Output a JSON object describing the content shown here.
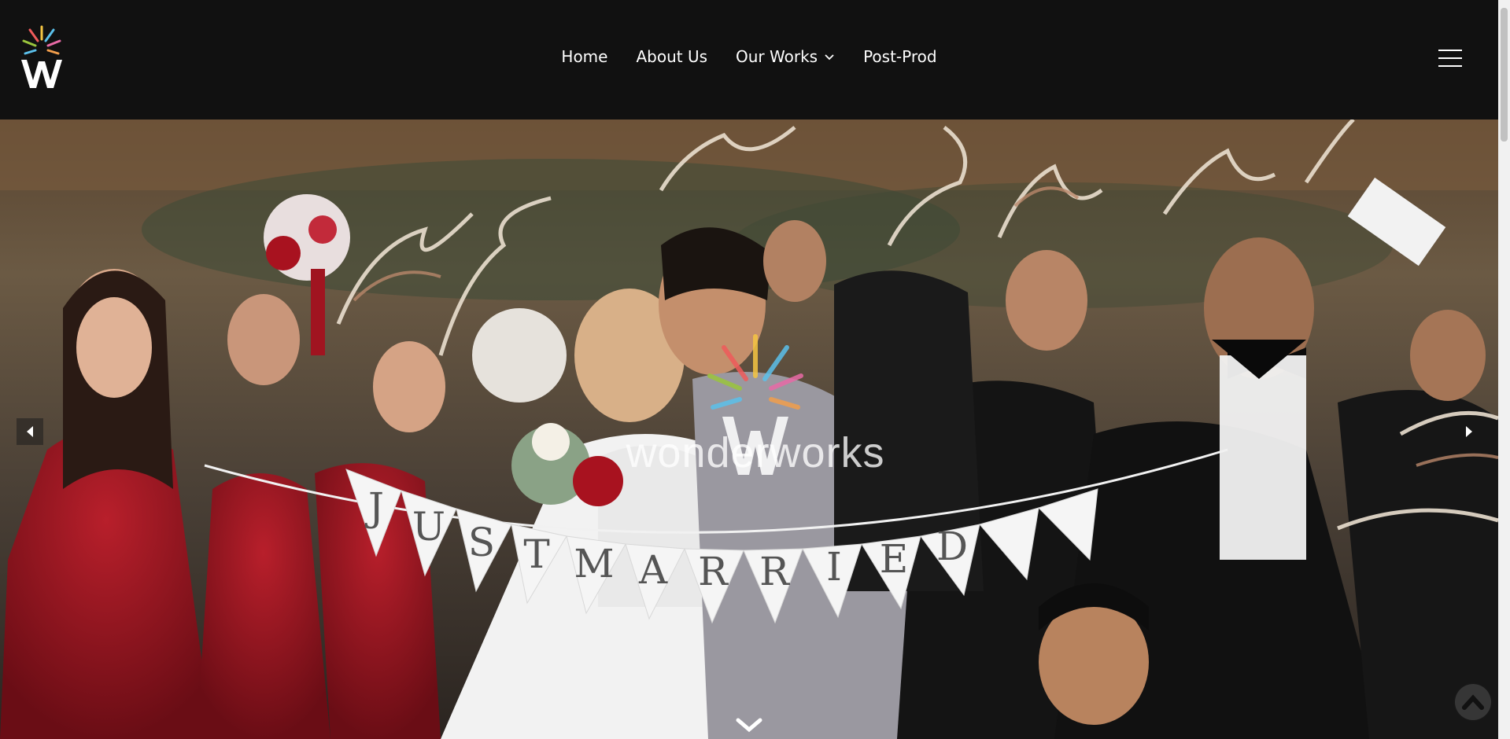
{
  "brand": {
    "name": "wonderworks",
    "logo_colors": [
      "#f5c542",
      "#ef5b5b",
      "#5bc0eb",
      "#9bc53d",
      "#e86aa6",
      "#f29e4c"
    ]
  },
  "nav": {
    "items": [
      {
        "label": "Home"
      },
      {
        "label": "About Us"
      },
      {
        "label": "Our Works",
        "has_dropdown": true
      },
      {
        "label": "Post-Prod"
      }
    ],
    "menu_icon": "hamburger-icon"
  },
  "hero": {
    "banner_text": "JUSTMARRIED",
    "prev_icon": "triangle-left-icon",
    "next_icon": "triangle-right-icon",
    "scroll_icon": "chevron-down-icon",
    "top_icon": "chevron-up-icon"
  }
}
